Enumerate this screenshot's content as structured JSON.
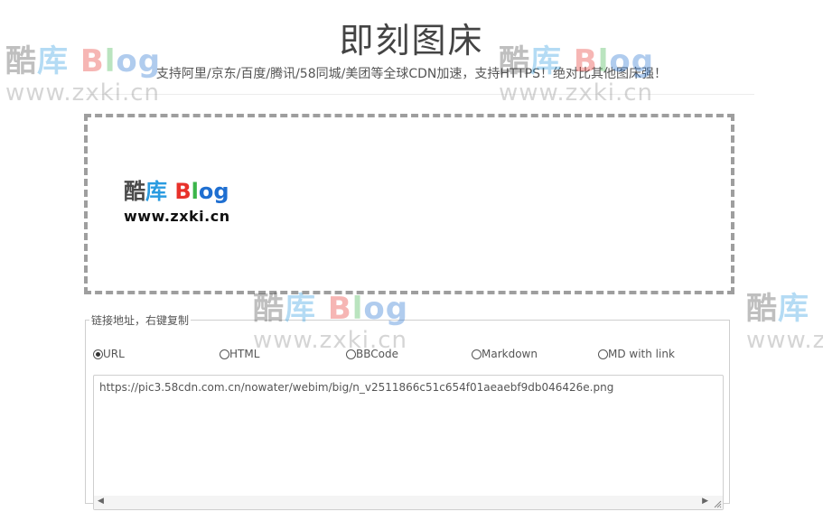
{
  "header": {
    "title": "即刻图床",
    "subtitle": "支持阿里/京东/百度/腾讯/58同城/美团等全球CDN加速，支持HTTPS！绝对比其他图床强！"
  },
  "watermark": {
    "part1": "酷",
    "part2": "库",
    "blog_b": "B",
    "blog_l": "l",
    "blog_o": "o",
    "blog_g": "g",
    "url": "www.zxki.cn"
  },
  "dropzone": {
    "logo_part1": "酷",
    "logo_part2": "库",
    "logo_b": "B",
    "logo_l": "l",
    "logo_o": "o",
    "logo_g": "g",
    "logo_url": "www.zxki.cn"
  },
  "links": {
    "legend": "链接地址，右键复制",
    "formats": [
      {
        "label": "URL",
        "selected": true
      },
      {
        "label": "HTML",
        "selected": false
      },
      {
        "label": "BBCode",
        "selected": false
      },
      {
        "label": "Markdown",
        "selected": false
      },
      {
        "label": "MD with link",
        "selected": false
      }
    ],
    "output": "https://pic3.58cdn.com.cn/nowater/webim/big/n_v2511866c51c654f01aeaebf9db046426e.png"
  },
  "colors": {
    "watermark_dark": "#4a4a4a",
    "watermark_blue": "#2a9be0",
    "blog_red": "#e8322b",
    "blog_green": "#3bb54a",
    "blog_blue": "#1f6fd1",
    "dropzone_border": "#9e9e9e"
  }
}
